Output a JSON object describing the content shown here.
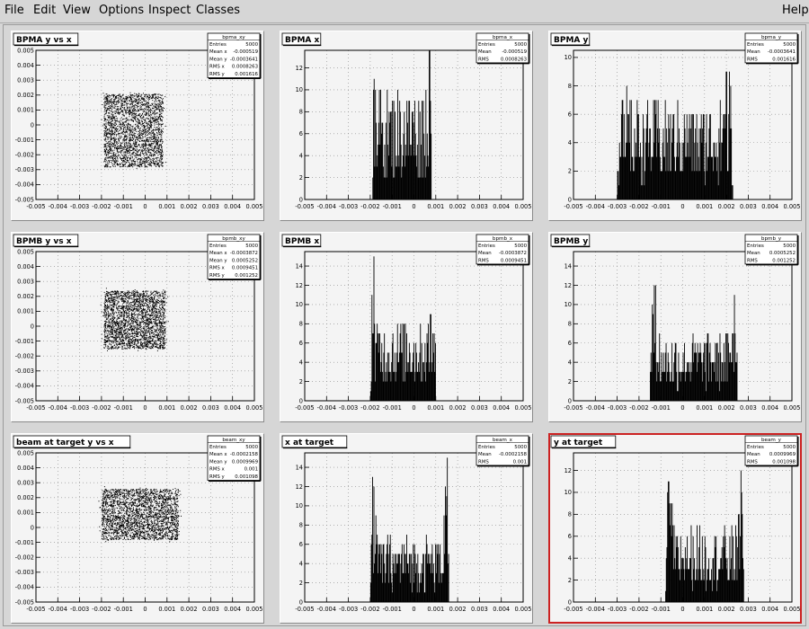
{
  "menu": {
    "file": "File",
    "edit": "Edit",
    "view": "View",
    "options": "Options",
    "inspect": "Inspect",
    "classes": "Classes",
    "help": "Help"
  },
  "accent_color": "#cc2222",
  "pads": [
    {
      "id": "bpma-xy",
      "type": "scatter",
      "title": "BPMA y vs x",
      "stats_name": "bpma_xy",
      "stats": [
        [
          "Entries",
          "5000"
        ],
        [
          "Mean x",
          "-0.000519"
        ],
        [
          "Mean y",
          "-0.0003641"
        ],
        [
          "RMS x",
          "0.0008263"
        ],
        [
          "RMS y",
          "0.001616"
        ]
      ],
      "xlim": [
        -0.005,
        0.005
      ],
      "ylim": [
        -0.005,
        0.005
      ],
      "xticks": [
        "-0.005",
        "-0.004",
        "-0.003",
        "-0.002",
        "-0.001",
        "0",
        "0.001",
        "0.002",
        "0.003",
        "0.004",
        "0.005"
      ],
      "yticks": [
        "-0.005",
        "-0.004",
        "-0.003",
        "-0.002",
        "-0.001",
        "0",
        "0.001",
        "0.002",
        "0.003",
        "0.004",
        "0.005"
      ],
      "region": {
        "x0": -0.0019,
        "x1": 0.0008,
        "y0": -0.0028,
        "y1": 0.0021
      }
    },
    {
      "id": "bpma-x",
      "type": "histogram",
      "title": "BPMA x",
      "stats_name": "bpma_x",
      "stats": [
        [
          "Entries",
          "5000"
        ],
        [
          "Mean",
          "-0.000519"
        ],
        [
          "RMS",
          "0.0008263"
        ]
      ],
      "xlim": [
        -0.005,
        0.005
      ],
      "ylim": [
        0,
        13.6
      ],
      "xticks": [
        "-0.005",
        "-0.004",
        "-0.003",
        "-0.002",
        "-0.001",
        "0",
        "0.001",
        "0.002",
        "0.003",
        "0.004",
        "0.005"
      ],
      "yticks": [
        "0",
        "2",
        "4",
        "6",
        "8",
        "10",
        "12"
      ],
      "region": {
        "x0": -0.0019,
        "x1": 0.0008,
        "edge": 13,
        "mid": 6
      }
    },
    {
      "id": "bpma-y",
      "type": "histogram",
      "title": "BPMA y",
      "stats_name": "bpma_y",
      "stats": [
        [
          "Entries",
          "5000"
        ],
        [
          "Mean",
          "-0.0003641"
        ],
        [
          "RMS",
          "0.001616"
        ]
      ],
      "xlim": [
        -0.005,
        0.005
      ],
      "ylim": [
        0,
        10.5
      ],
      "xticks": [
        "-0.005",
        "-0.004",
        "-0.003",
        "-0.002",
        "-0.001",
        "0",
        "0.001",
        "0.002",
        "0.003",
        "0.004",
        "0.005"
      ],
      "yticks": [
        "0",
        "2",
        "4",
        "6",
        "8",
        "10"
      ],
      "region": {
        "x0": -0.003,
        "x1": 0.0023,
        "edge": 8.5,
        "mid": 4
      }
    },
    {
      "id": "bpmb-xy",
      "type": "scatter",
      "title": "BPMB y vs x",
      "stats_name": "bpmb_xy",
      "stats": [
        [
          "Entries",
          "5000"
        ],
        [
          "Mean x",
          "-0.0003872"
        ],
        [
          "Mean y",
          "0.0005252"
        ],
        [
          "RMS x",
          "0.0009451"
        ],
        [
          "RMS y",
          "0.001252"
        ]
      ],
      "xlim": [
        -0.005,
        0.005
      ],
      "ylim": [
        -0.005,
        0.005
      ],
      "xticks": [
        "-0.005",
        "-0.004",
        "-0.003",
        "-0.002",
        "-0.001",
        "0",
        "0.001",
        "0.002",
        "0.003",
        "0.004",
        "0.005"
      ],
      "yticks": [
        "-0.005",
        "-0.004",
        "-0.003",
        "-0.002",
        "-0.001",
        "0",
        "0.001",
        "0.002",
        "0.003",
        "0.004",
        "0.005"
      ],
      "region": {
        "x0": -0.0019,
        "x1": 0.0009,
        "y0": -0.0015,
        "y1": 0.0024
      }
    },
    {
      "id": "bpmb-x",
      "type": "histogram",
      "title": "BPMB x",
      "stats_name": "bpmb_x",
      "stats": [
        [
          "Entries",
          "5000"
        ],
        [
          "Mean",
          "-0.0003872"
        ],
        [
          "RMS",
          "0.0009451"
        ]
      ],
      "xlim": [
        -0.005,
        0.005
      ],
      "ylim": [
        0,
        15.5
      ],
      "xticks": [
        "-0.005",
        "-0.004",
        "-0.003",
        "-0.002",
        "-0.001",
        "0",
        "0.001",
        "0.002",
        "0.003",
        "0.004",
        "0.005"
      ],
      "yticks": [
        "0",
        "2",
        "4",
        "6",
        "8",
        "10",
        "12",
        "14"
      ],
      "region": {
        "x0": -0.002,
        "x1": 0.001,
        "edge": 13,
        "mid": 5
      }
    },
    {
      "id": "bpmb-y",
      "type": "histogram",
      "title": "BPMB y",
      "stats_name": "bpmb_y",
      "stats": [
        [
          "Entries",
          "5000"
        ],
        [
          "Mean",
          "0.0005252"
        ],
        [
          "RMS",
          "0.001252"
        ]
      ],
      "xlim": [
        -0.005,
        0.005
      ],
      "ylim": [
        0,
        15.5
      ],
      "xticks": [
        "-0.005",
        "-0.004",
        "-0.003",
        "-0.002",
        "-0.001",
        "0",
        "0.001",
        "0.002",
        "0.003",
        "0.004",
        "0.005"
      ],
      "yticks": [
        "0",
        "2",
        "4",
        "6",
        "8",
        "10",
        "12",
        "14"
      ],
      "region": {
        "x0": -0.0015,
        "x1": 0.0025,
        "edge": 12,
        "mid": 4
      }
    },
    {
      "id": "beam-xy",
      "type": "scatter",
      "title": "beam at target y vs x",
      "stats_name": "beam_xy",
      "stats": [
        [
          "Entries",
          "5000"
        ],
        [
          "Mean x",
          "-0.0002158"
        ],
        [
          "Mean y",
          "0.0009969"
        ],
        [
          "RMS x",
          "0.001"
        ],
        [
          "RMS y",
          "0.001098"
        ]
      ],
      "xlim": [
        -0.005,
        0.005
      ],
      "ylim": [
        -0.005,
        0.005
      ],
      "xticks": [
        "-0.005",
        "-0.004",
        "-0.003",
        "-0.002",
        "-0.001",
        "0",
        "0.001",
        "0.002",
        "0.003",
        "0.004",
        "0.005"
      ],
      "yticks": [
        "-0.005",
        "-0.004",
        "-0.003",
        "-0.002",
        "-0.001",
        "0",
        "0.001",
        "0.002",
        "0.003",
        "0.004",
        "0.005"
      ],
      "region": {
        "x0": -0.002,
        "x1": 0.0015,
        "y0": -0.0008,
        "y1": 0.0026
      }
    },
    {
      "id": "x-target",
      "type": "histogram",
      "title": "x at target",
      "stats_name": "beam_x",
      "stats": [
        [
          "Entries",
          "5000"
        ],
        [
          "Mean",
          "-0.0002158"
        ],
        [
          "RMS",
          "0.001"
        ]
      ],
      "xlim": [
        -0.005,
        0.005
      ],
      "ylim": [
        0,
        15.5
      ],
      "xticks": [
        "-0.005",
        "-0.004",
        "-0.003",
        "-0.002",
        "-0.001",
        "0",
        "0.001",
        "0.002",
        "0.003",
        "0.004",
        "0.005"
      ],
      "yticks": [
        "0",
        "2",
        "4",
        "6",
        "8",
        "10",
        "12",
        "14"
      ],
      "region": {
        "x0": -0.002,
        "x1": 0.0016,
        "edge": 11,
        "mid": 4
      }
    },
    {
      "id": "y-target",
      "type": "histogram",
      "title": "y at target",
      "stats_name": "beam_y",
      "stats": [
        [
          "Entries",
          "5000"
        ],
        [
          "Mean",
          "0.0009969"
        ],
        [
          "RMS",
          "0.001098"
        ]
      ],
      "xlim": [
        -0.005,
        0.005
      ],
      "ylim": [
        0,
        13.6
      ],
      "xticks": [
        "-0.005",
        "-0.004",
        "-0.003",
        "-0.002",
        "-0.001",
        "0",
        "0.001",
        "0.002",
        "0.003",
        "0.004",
        "0.005"
      ],
      "yticks": [
        "0",
        "2",
        "4",
        "6",
        "8",
        "10",
        "12"
      ],
      "region": {
        "x0": -0.0008,
        "x1": 0.0028,
        "edge": 11,
        "mid": 4
      },
      "selected": true
    }
  ],
  "chart_data": [
    {
      "type": "scatter",
      "title": "BPMA y vs x",
      "xlim": [
        -0.005,
        0.005
      ],
      "ylim": [
        -0.005,
        0.005
      ],
      "grid": true,
      "legend": "top-right"
    },
    {
      "type": "bar",
      "title": "BPMA x",
      "xlim": [
        -0.005,
        0.005
      ],
      "ylim": [
        0,
        13.6
      ],
      "grid": true,
      "legend": "top-right"
    },
    {
      "type": "bar",
      "title": "BPMA y",
      "xlim": [
        -0.005,
        0.005
      ],
      "ylim": [
        0,
        10.5
      ],
      "grid": true,
      "legend": "top-right"
    },
    {
      "type": "scatter",
      "title": "BPMB y vs x",
      "xlim": [
        -0.005,
        0.005
      ],
      "ylim": [
        -0.005,
        0.005
      ],
      "grid": true,
      "legend": "top-right"
    },
    {
      "type": "bar",
      "title": "BPMB x",
      "xlim": [
        -0.005,
        0.005
      ],
      "ylim": [
        0,
        15.5
      ],
      "grid": true,
      "legend": "top-right"
    },
    {
      "type": "bar",
      "title": "BPMB y",
      "xlim": [
        -0.005,
        0.005
      ],
      "ylim": [
        0,
        15.5
      ],
      "grid": true,
      "legend": "top-right"
    },
    {
      "type": "scatter",
      "title": "beam at target y vs x",
      "xlim": [
        -0.005,
        0.005
      ],
      "ylim": [
        -0.005,
        0.005
      ],
      "grid": true,
      "legend": "top-right"
    },
    {
      "type": "bar",
      "title": "x at target",
      "xlim": [
        -0.005,
        0.005
      ],
      "ylim": [
        0,
        15.5
      ],
      "grid": true,
      "legend": "top-right"
    },
    {
      "type": "bar",
      "title": "y at target",
      "xlim": [
        -0.005,
        0.005
      ],
      "ylim": [
        0,
        13.6
      ],
      "grid": true,
      "legend": "top-right"
    }
  ]
}
